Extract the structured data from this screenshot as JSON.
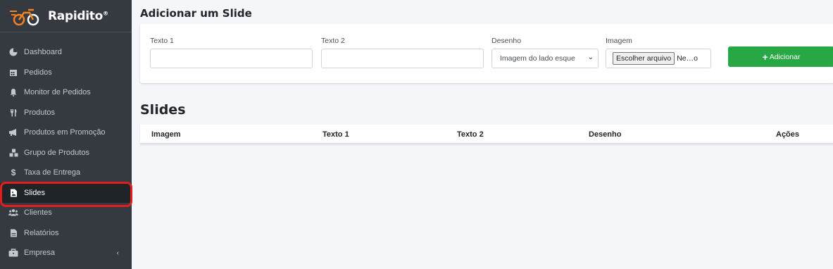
{
  "brand": {
    "name": "Rapidito",
    "mark": "®"
  },
  "sidebar": {
    "items": [
      {
        "label": "Dashboard",
        "icon": "dashboard-icon"
      },
      {
        "label": "Pedidos",
        "icon": "calendar-icon"
      },
      {
        "label": "Monitor de Pedidos",
        "icon": "bell-icon"
      },
      {
        "label": "Produtos",
        "icon": "utensils-icon"
      },
      {
        "label": "Produtos em Promoção",
        "icon": "megaphone-icon"
      },
      {
        "label": "Grupo de Produtos",
        "icon": "cubes-icon"
      },
      {
        "label": "Taxa de Entrega",
        "icon": "dollar-icon"
      },
      {
        "label": "Slides",
        "icon": "image-file-icon",
        "active": true
      },
      {
        "label": "Clientes",
        "icon": "users-icon"
      },
      {
        "label": "Relatórios",
        "icon": "file-icon"
      },
      {
        "label": "Empresa",
        "icon": "briefcase-icon",
        "chevron": "‹"
      }
    ]
  },
  "main": {
    "title": "Adicionar um Slide",
    "form": {
      "texto1": {
        "label": "Texto 1",
        "value": ""
      },
      "texto2": {
        "label": "Texto 2",
        "value": ""
      },
      "desenho": {
        "label": "Desenho",
        "selected": "Imagem do lado esque"
      },
      "imagem": {
        "label": "Imagem",
        "button": "Escolher arquivo",
        "status": "Ne…o"
      },
      "add_button": "Adicionar"
    },
    "section_title": "Slides",
    "table": {
      "columns": [
        "Imagem",
        "Texto 1",
        "Texto 2",
        "Desenho",
        "Ações"
      ]
    }
  },
  "colors": {
    "sidebar": "#343a40",
    "accent": "#f58220",
    "success": "#28a745",
    "highlight": "#e01e1e"
  }
}
